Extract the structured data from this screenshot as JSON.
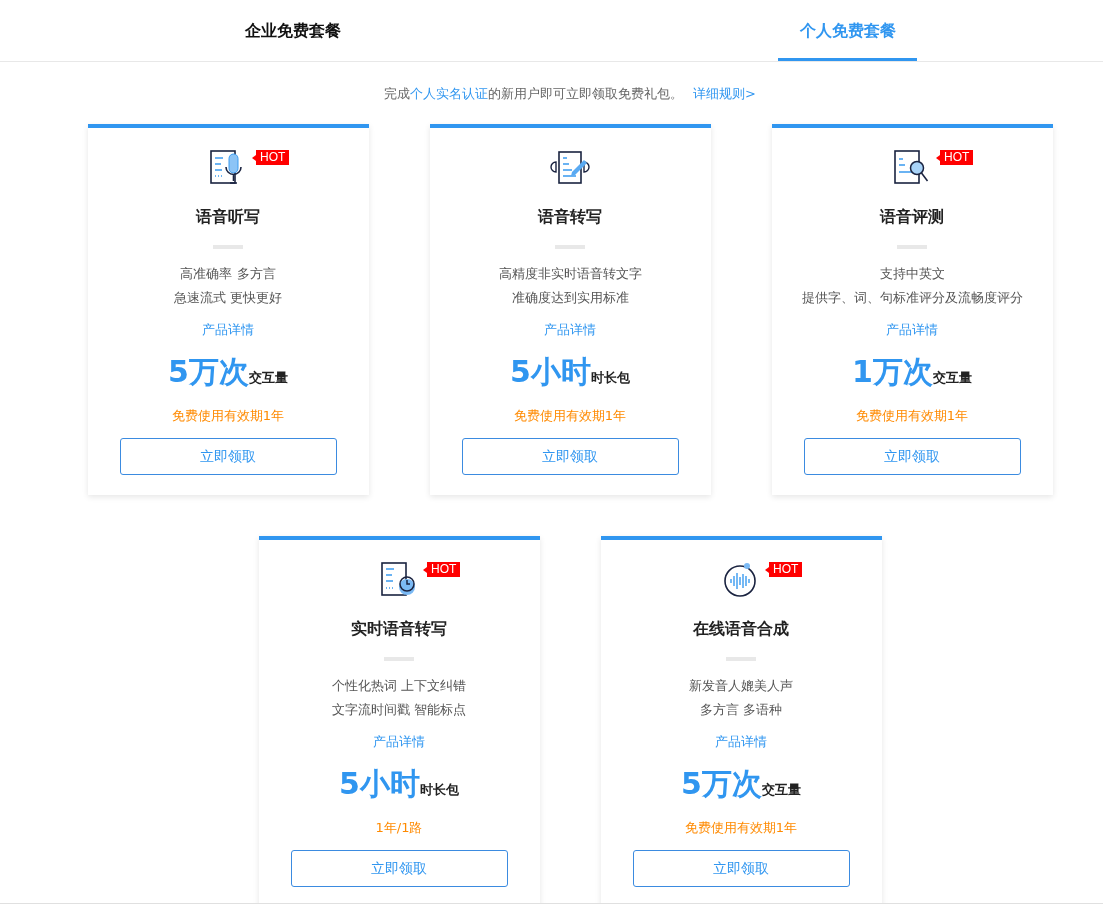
{
  "tabs": [
    {
      "label": "企业免费套餐",
      "selected": false
    },
    {
      "label": "个人免费套餐",
      "selected": true
    }
  ],
  "notice": {
    "before": "完成",
    "link": "个人实名认证",
    "after": "的新用户即可立即领取免费礼包。",
    "rules_link": "详细规则>"
  },
  "cards": [
    {
      "kind": "dictation",
      "hot": true,
      "hot_label": "HOT",
      "title": "语音听写",
      "features": [
        "高准确率 多方言",
        "急速流式 更快更好"
      ],
      "details_link": "产品详情",
      "amount": "5万次",
      "unit": "交互量",
      "validity": "免费使用有效期1年",
      "button": "立即领取"
    },
    {
      "kind": "transcription",
      "hot": false,
      "title": "语音转写",
      "features": [
        "高精度非实时语音转文字",
        "准确度达到实用标准"
      ],
      "details_link": "产品详情",
      "amount": "5小时",
      "unit": "时长包",
      "validity": "免费使用有效期1年",
      "button": "立即领取"
    },
    {
      "kind": "evaluation",
      "hot": true,
      "hot_label": "HOT",
      "title": "语音评测",
      "features": [
        "支持中英文",
        "提供字、词、句标准评分及流畅度评分"
      ],
      "details_link": "产品详情",
      "amount": "1万次",
      "unit": "交互量",
      "validity": "免费使用有效期1年",
      "button": "立即领取"
    },
    {
      "kind": "realtime",
      "hot": true,
      "hot_label": "HOT",
      "title": "实时语音转写",
      "features": [
        "个性化热词 上下文纠错",
        "文字流时间戳 智能标点"
      ],
      "details_link": "产品详情",
      "amount": "5小时",
      "unit": "时长包",
      "validity": "1年/1路",
      "button": "立即领取"
    },
    {
      "kind": "synthesis",
      "hot": true,
      "hot_label": "HOT",
      "title": "在线语音合成",
      "features": [
        "新发音人媲美人声",
        "多方言 多语种"
      ],
      "details_link": "产品详情",
      "amount": "5万次",
      "unit": "交互量",
      "validity": "免费使用有效期1年",
      "button": "立即领取"
    }
  ]
}
